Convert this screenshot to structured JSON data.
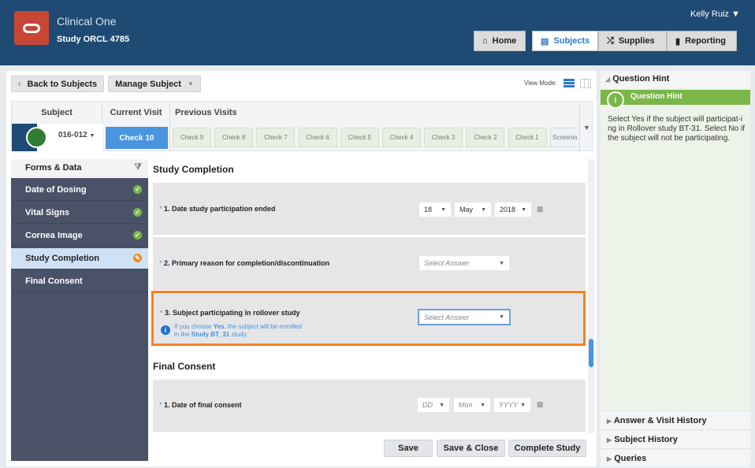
{
  "header": {
    "app_title": "Clinical One",
    "study": "Study ORCL 4785",
    "user": "Kelly Ruiz",
    "nav": [
      {
        "label": "Home",
        "icon": "home-icon"
      },
      {
        "label": "Subjects",
        "icon": "clipboard-icon"
      },
      {
        "label": "Supplies",
        "icon": "shuffle-icon"
      },
      {
        "label": "Reporting",
        "icon": "bar-chart-icon"
      }
    ]
  },
  "toolbar": {
    "back": "Back to Subjects",
    "manage": "Manage Subject",
    "view_mode": "View Mode:"
  },
  "visits": {
    "subject_header": "Subject",
    "current_header": "Current Visit",
    "previous_header": "Previous Visits",
    "subject_id": "016-012",
    "current": "Check 10",
    "previous": [
      "Check 9",
      "Check 8",
      "Check 7",
      "Check 6",
      "Check 5",
      "Check 4",
      "Check 3",
      "Check 2",
      "Check 1",
      "Screenin"
    ]
  },
  "forms": {
    "header": "Forms & Data",
    "items": [
      {
        "label": "Date of Dosing",
        "status": "complete"
      },
      {
        "label": "Vital Signs",
        "status": "complete"
      },
      {
        "label": "Cornea Image",
        "status": "complete"
      },
      {
        "label": "Study Completion",
        "status": "in-progress"
      },
      {
        "label": "Final Consent",
        "status": "none"
      }
    ]
  },
  "form": {
    "section1": "Study Completion",
    "q1": {
      "label": "1. Date study participation ended",
      "day": "18",
      "month": "May",
      "year": "2018"
    },
    "q2": {
      "label": "2. Primary reason for completion/discontinuation",
      "placeholder": "Select Answer"
    },
    "q3": {
      "label": "3. Subject participating in rollover study",
      "placeholder": "Select Answer",
      "hint_a": "If you choose ",
      "hint_yes": "Yes",
      "hint_b": ", the subject will be enrolled",
      "hint_c": "in the ",
      "hint_study": "Study BT_31",
      "hint_d": " study."
    },
    "section2": "Final Consent",
    "q4": {
      "label": "1. Date of final consent",
      "day": "DD",
      "month": "Mon",
      "year": "YYYY"
    },
    "required": "*"
  },
  "actions": {
    "save": "Save",
    "save_close": "Save & Close",
    "complete": "Complete Study"
  },
  "hint": {
    "panel_title": "Question Hint",
    "box_title": "Question Hint",
    "text": "Select Yes if the subject will participat-ing in Rollover study BT-31. Select No if the subject will not be participating."
  },
  "accordions": [
    "Answer & Visit History",
    "Subject History",
    "Queries"
  ],
  "colors": {
    "header": "#1e4a74",
    "accent": "#2a7bd0",
    "highlight": "#f58220",
    "hint_green": "#7ab648"
  }
}
